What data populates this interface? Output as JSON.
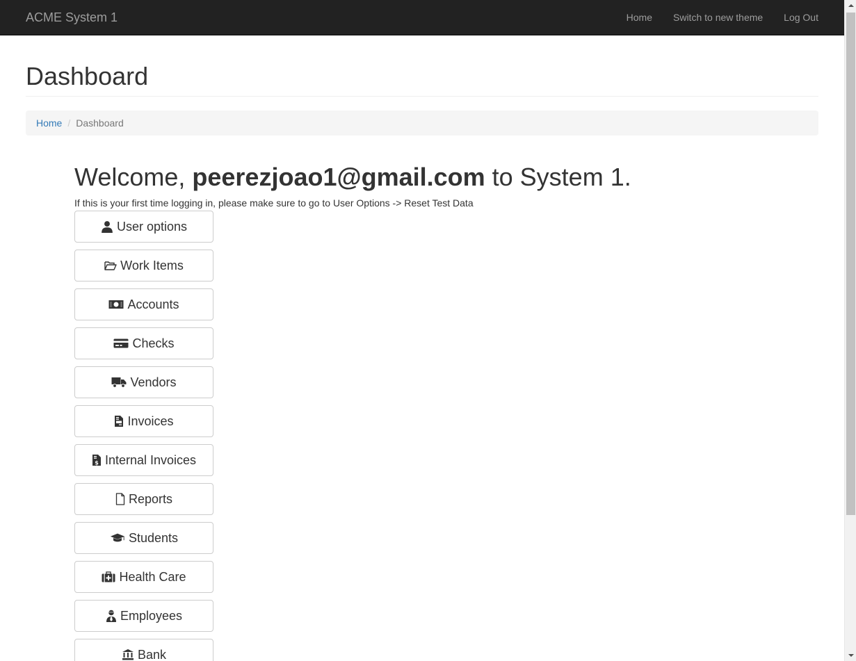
{
  "navbar": {
    "brand": "ACME System 1",
    "links": [
      "Home",
      "Switch to new theme",
      "Log Out"
    ]
  },
  "page": {
    "title": "Dashboard"
  },
  "breadcrumb": {
    "home": "Home",
    "current": "Dashboard"
  },
  "welcome": {
    "prefix": "Welcome, ",
    "user": "peerezjoao1@gmail.com",
    "suffix": " to System 1.",
    "hint": "If this is your first time logging in, please make sure to go to User Options -> Reset Test Data"
  },
  "menu": {
    "items": [
      {
        "label": "User options",
        "icon": "user-icon"
      },
      {
        "label": "Work Items",
        "icon": "folder-open-icon"
      },
      {
        "label": "Accounts",
        "icon": "money-bill-icon"
      },
      {
        "label": "Checks",
        "icon": "credit-card-icon"
      },
      {
        "label": "Vendors",
        "icon": "truck-icon"
      },
      {
        "label": "Invoices",
        "icon": "file-invoice-icon"
      },
      {
        "label": "Internal Invoices",
        "icon": "file-invoice-dollar-icon"
      },
      {
        "label": "Reports",
        "icon": "file-icon"
      },
      {
        "label": "Students",
        "icon": "graduation-cap-icon"
      },
      {
        "label": "Health Care",
        "icon": "medkit-icon"
      },
      {
        "label": "Employees",
        "icon": "user-tie-icon"
      },
      {
        "label": "Bank",
        "icon": "bank-icon"
      }
    ]
  }
}
